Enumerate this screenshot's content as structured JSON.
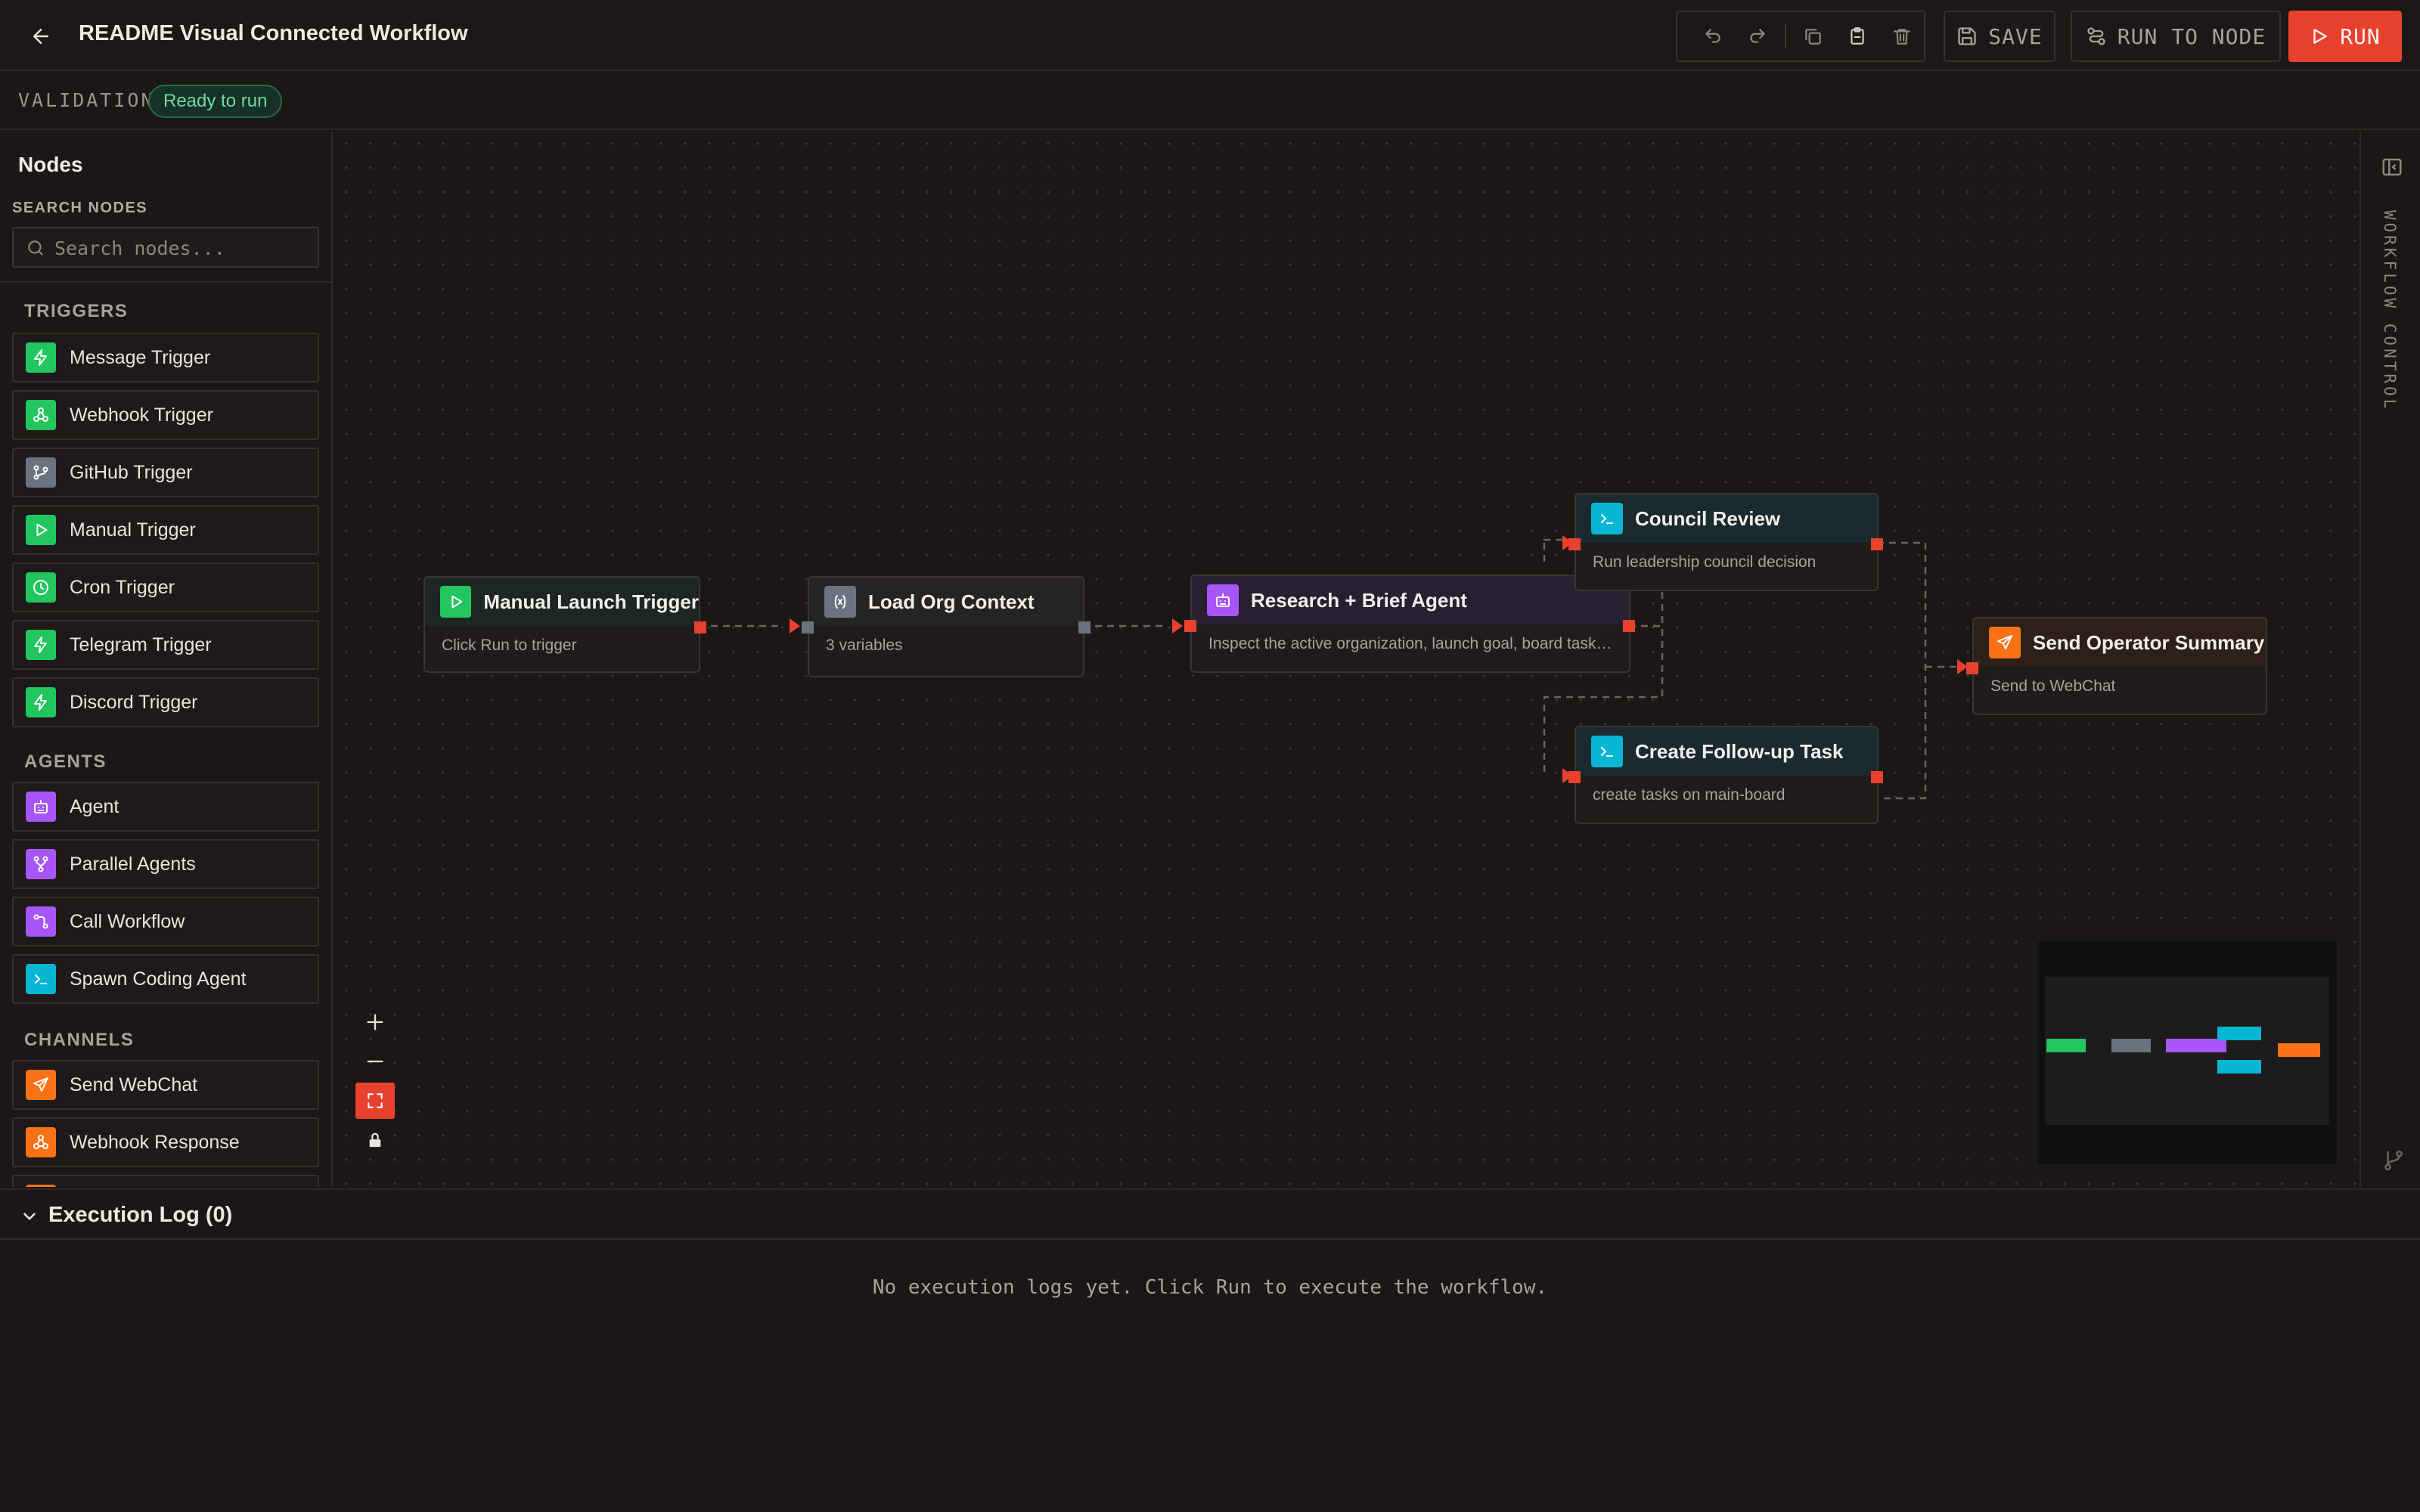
{
  "header": {
    "title": "README Visual Connected Workflow",
    "save_label": "SAVE",
    "run_to_node_label": "RUN TO NODE",
    "run_label": "RUN",
    "toolbar_icons": [
      "undo-icon",
      "redo-icon",
      "duplicate-icon",
      "paste-icon",
      "trash-icon"
    ]
  },
  "validation": {
    "label": "VALIDATION",
    "status": "Ready to run",
    "status_color": "#6fdc9c"
  },
  "sidebar": {
    "title": "Nodes",
    "search_label": "SEARCH NODES",
    "search_placeholder": "Search nodes...",
    "sections": [
      {
        "label": "TRIGGERS",
        "items": [
          {
            "label": "Message Trigger",
            "icon": "bolt-icon",
            "color": "#22c55e"
          },
          {
            "label": "Webhook Trigger",
            "icon": "webhook-icon",
            "color": "#22c55e"
          },
          {
            "label": "GitHub Trigger",
            "icon": "git-branch-icon",
            "color": "#6b7280"
          },
          {
            "label": "Manual Trigger",
            "icon": "play-icon",
            "color": "#22c55e"
          },
          {
            "label": "Cron Trigger",
            "icon": "clock-icon",
            "color": "#22c55e"
          },
          {
            "label": "Telegram Trigger",
            "icon": "bolt-icon",
            "color": "#22c55e"
          },
          {
            "label": "Discord Trigger",
            "icon": "bolt-icon",
            "color": "#22c55e"
          }
        ]
      },
      {
        "label": "AGENTS",
        "items": [
          {
            "label": "Agent",
            "icon": "robot-icon",
            "color": "#a855f7"
          },
          {
            "label": "Parallel Agents",
            "icon": "fork-icon",
            "color": "#a855f7"
          },
          {
            "label": "Call Workflow",
            "icon": "workflow-icon",
            "color": "#a855f7"
          },
          {
            "label": "Spawn Coding Agent",
            "icon": "terminal-icon",
            "color": "#06b6d4"
          }
        ]
      },
      {
        "label": "CHANNELS",
        "items": [
          {
            "label": "Send WebChat",
            "icon": "send-icon",
            "color": "#f97316"
          },
          {
            "label": "Webhook Response",
            "icon": "webhook-icon",
            "color": "#f97316"
          }
        ]
      }
    ]
  },
  "canvas": {
    "nodes": [
      {
        "id": "manual-launch-trigger",
        "title": "Manual Launch Trigger",
        "subtitle": "Click Run to trigger",
        "icon": "play-icon",
        "color": "#22c55e"
      },
      {
        "id": "load-org-context",
        "title": "Load Org Context",
        "subtitle": "3 variables",
        "icon": "variable-icon",
        "color": "#6b7280"
      },
      {
        "id": "research-brief-agent",
        "title": "Research + Brief Agent",
        "subtitle": "Inspect the active organization, launch goal, board tasks, a...",
        "icon": "robot-icon",
        "color": "#a855f7"
      },
      {
        "id": "council-review",
        "title": "Council Review",
        "subtitle": "Run leadership council decision",
        "icon": "terminal-icon",
        "color": "#06b6d4"
      },
      {
        "id": "create-follow-up-task",
        "title": "Create Follow-up Task",
        "subtitle": "create tasks on main-board",
        "icon": "terminal-icon",
        "color": "#06b6d4"
      },
      {
        "id": "send-operator-summary",
        "title": "Send Operator Summary",
        "subtitle": "Send to WebChat",
        "icon": "send-icon",
        "color": "#f97316"
      }
    ],
    "zoom_controls": [
      "zoom-in-icon",
      "zoom-out-icon",
      "fit-view-icon",
      "lock-icon"
    ],
    "port_color": "#e8412e"
  },
  "right_rail": {
    "label": "WORKFLOW CONTROL"
  },
  "execution_log": {
    "title": "Execution Log (0)",
    "empty_message": "No execution logs yet. Click Run to execute the workflow."
  }
}
